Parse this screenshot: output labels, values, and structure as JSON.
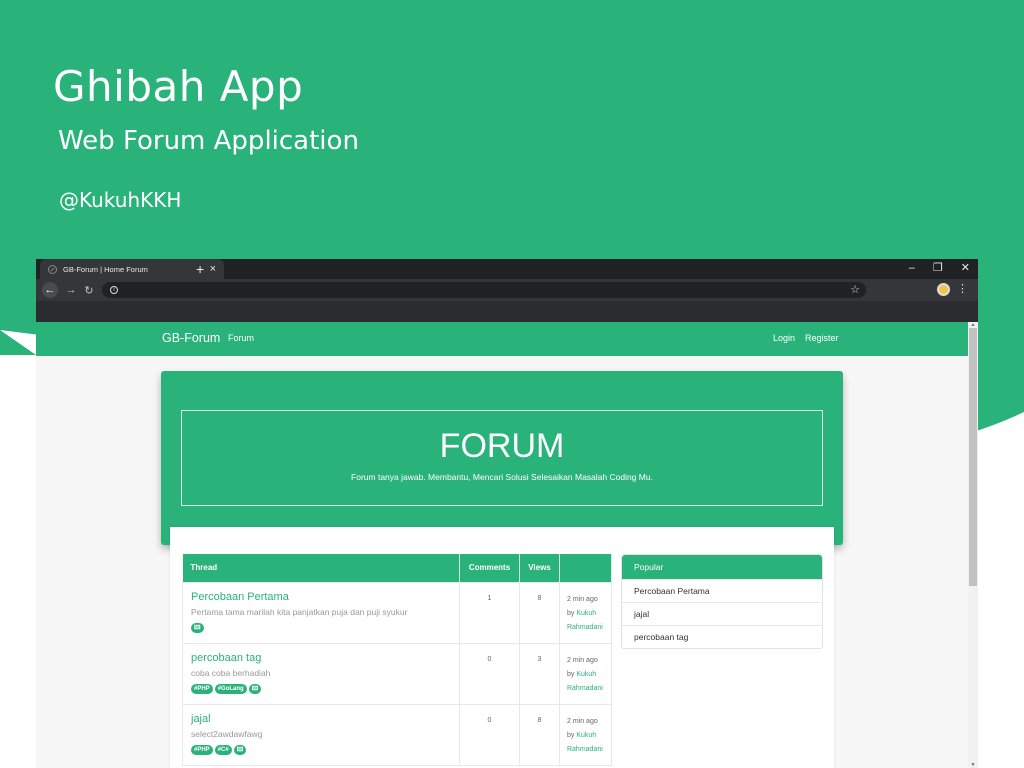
{
  "promo": {
    "title": "Ghibah App",
    "subtitle": "Web Forum Application",
    "handle": "@KukuhKKH",
    "colors": {
      "accent": "#2ab27b"
    }
  },
  "browser": {
    "tab_title": "GB-Forum | Home Forum",
    "icons": {
      "tab_close": "×",
      "new_tab": "+",
      "minimize": "–",
      "restore": "❐",
      "close": "✕",
      "back": "←",
      "forward": "→",
      "reload": "↻",
      "info": "i",
      "star": "☆",
      "menu": "⋮"
    }
  },
  "site": {
    "brand": "GB-Forum",
    "nav": {
      "forum": "Forum",
      "login": "Login",
      "register": "Register"
    },
    "hero": {
      "title": "FORUM",
      "description": "Forum tanya jawab. Membantu, Mencari Solusi Selesaikan Masalah Coding Mu."
    },
    "table": {
      "headers": {
        "thread": "Thread",
        "comments": "Comments",
        "views": "Views"
      },
      "rows": [
        {
          "title": "Percobaan Pertama",
          "desc": "Pertama tama marilah kita panjatkan puja dan puji syukur",
          "tags": [
            "🖾"
          ],
          "comments": "1",
          "views": "8",
          "time": "2 min ago",
          "by": "by",
          "author_first": "Kukuh",
          "author_last": "Rahmadani"
        },
        {
          "title": "percobaan tag",
          "desc": "coba coba berhadiah",
          "tags": [
            "#PHP",
            "#GoLang",
            "🖾"
          ],
          "comments": "0",
          "views": "3",
          "time": "2 min ago",
          "by": "by",
          "author_first": "Kukuh",
          "author_last": "Rahmadani"
        },
        {
          "title": "jajal",
          "desc": "select2awdawfawg",
          "tags": [
            "#PHP",
            "#C#",
            "🖾"
          ],
          "comments": "0",
          "views": "8",
          "time": "2 min ago",
          "by": "by",
          "author_first": "Kukuh",
          "author_last": "Rahmadani"
        }
      ]
    },
    "popular": {
      "heading": "Popular",
      "items": [
        "Percobaan Pertama",
        "jajal",
        "percobaan tag"
      ]
    }
  }
}
